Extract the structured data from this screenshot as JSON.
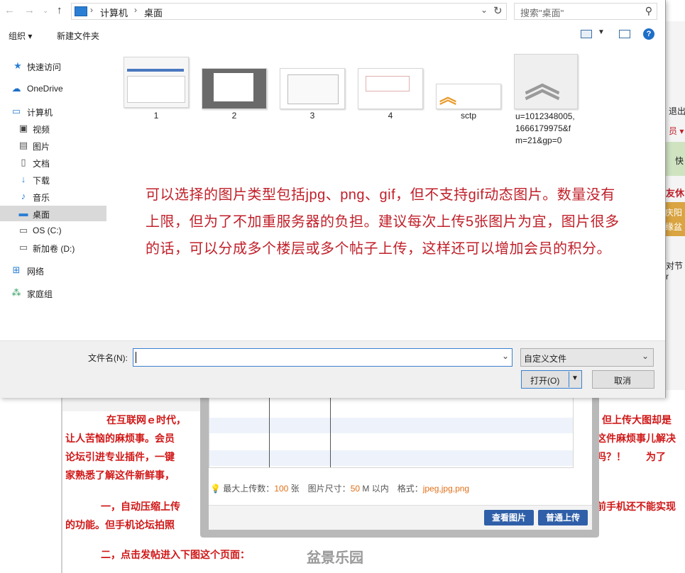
{
  "dialog": {
    "address": {
      "crumbs": [
        "计算机",
        "桌面"
      ],
      "sep": "›"
    },
    "search_placeholder": "搜索\"桌面\"",
    "toolbar": {
      "organize": "组织 ▾",
      "new_folder": "新建文件夹"
    },
    "nav": [
      {
        "label": "快速访问",
        "icon": "star-icon"
      },
      {
        "label": "OneDrive",
        "icon": "cloud-icon"
      },
      {
        "label": "计算机",
        "icon": "computer-icon"
      },
      {
        "label": "视频",
        "icon": "video-folder-icon"
      },
      {
        "label": "图片",
        "icon": "picture-folder-icon"
      },
      {
        "label": "文档",
        "icon": "document-folder-icon"
      },
      {
        "label": "下载",
        "icon": "download-icon"
      },
      {
        "label": "音乐",
        "icon": "music-icon"
      },
      {
        "label": "桌面",
        "icon": "desktop-icon",
        "selected": true
      },
      {
        "label": "OS (C:)",
        "icon": "drive-icon"
      },
      {
        "label": "新加卷 (D:)",
        "icon": "drive-icon"
      },
      {
        "label": "网络",
        "icon": "network-icon"
      },
      {
        "label": "家庭组",
        "icon": "homegroup-icon"
      }
    ],
    "files": [
      "1",
      "2",
      "3",
      "4",
      "sctp",
      "u=1012348005,\n1666179975&f\nm=21&gp=0"
    ],
    "overlay_text": "可以选择的图片类型包括jpg、png、gif，但不支持gif动态图片。数量没有上限，但为了不加重服务器的负担。建议每次上传5张图片为宜，图片很多的话，可以分成多个楼层或多个帖子上传，这样还可以增加会员的积分。",
    "file_name_label": "文件名(N):",
    "file_name_value": "",
    "file_type": "自定义文件",
    "open_label": "打开(O)",
    "cancel_label": "取消"
  },
  "upload": {
    "note_prefix": "最大上传数：",
    "max_count": "100",
    "note_mid1": " 张　图片尺寸：",
    "max_size": "50",
    "note_mid2": " M 以内　格式：",
    "formats": "jpeg,jpg,png",
    "view_button": "查看图片",
    "upload_button": "普通上传"
  },
  "background": {
    "right_items": [
      "退出",
      "员 ▾",
      "快",
      "友休",
      "庆阳",
      "缘盆",
      "对节r"
    ],
    "article_lines": [
      "在互联网ｅ时代，",
      "但上传大图却是",
      "让人苦恼的麻烦事。会员",
      "这件麻烦事儿解决",
      "论坛引进专业插件，一键",
      "吗？！　　为了",
      "家熟悉了解这件新鲜事，",
      "一，自动压缩上传",
      "前手机还不能实现",
      "的功能。但手机论坛拍照",
      "二，点击发帖进入下图这个页面："
    ],
    "watermark": "盆景乐园"
  }
}
